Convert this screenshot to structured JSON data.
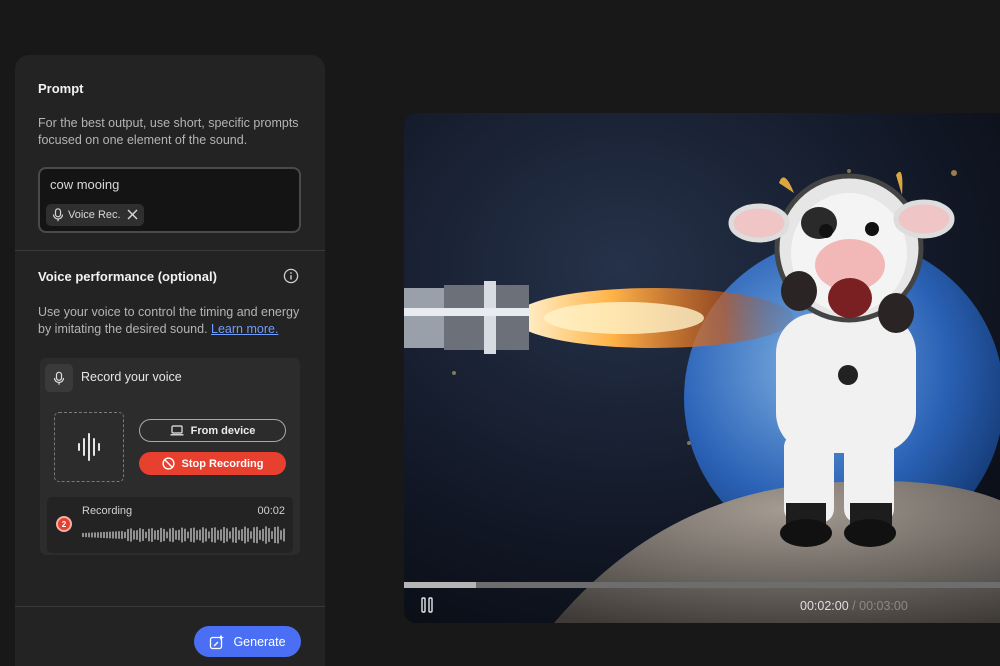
{
  "prompt": {
    "title": "Prompt",
    "help": "For the best output, use short, specific prompts focused on one element of the sound.",
    "value": "cow mooing",
    "chip_label": "Voice Rec.",
    "chip_icon": "microphone-icon",
    "chip_close_icon": "close-icon"
  },
  "voice": {
    "title": "Voice performance (optional)",
    "info_icon": "info-icon",
    "help": "Use your voice to control the timing and energy by imitating the desired sound.",
    "learn_more": "Learn more.",
    "record_title": "Record your voice",
    "from_device_label": "From device",
    "stop_label": "Stop Recording",
    "recording": {
      "label": "Recording",
      "time": "00:02",
      "badge": "2"
    }
  },
  "generate_label": "Generate",
  "player": {
    "current_time": "00:02:00",
    "separator": "/",
    "total_time": "00:03:00",
    "progress": 0.12
  },
  "colors": {
    "accent_blue": "#4a6ff5",
    "stop_red": "#e8402e",
    "link_blue": "#6f9cff",
    "panel_bg": "#232323"
  }
}
